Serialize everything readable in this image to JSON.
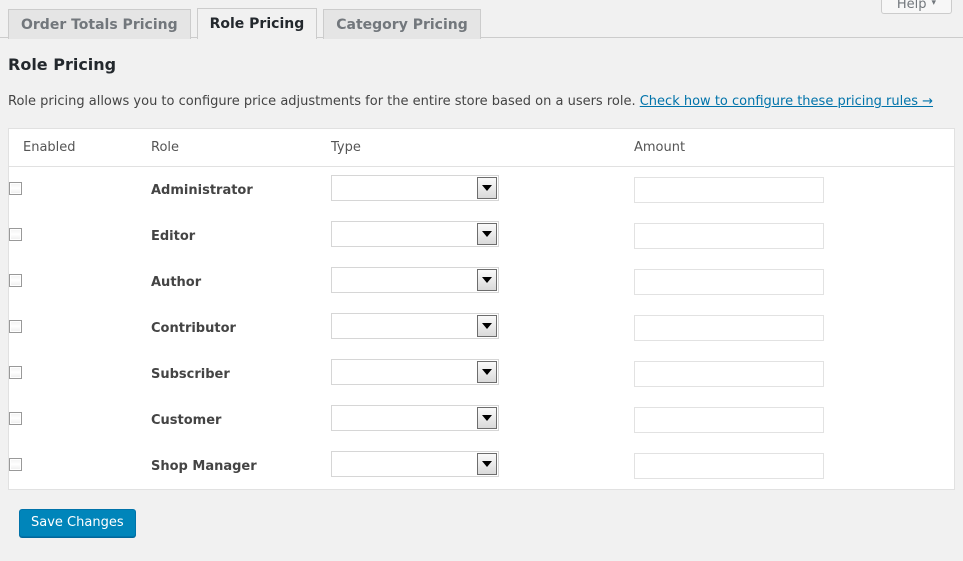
{
  "help": {
    "label": "Help",
    "caret": "▾"
  },
  "tabs": [
    {
      "label": "Order Totals Pricing",
      "active": false
    },
    {
      "label": "Role Pricing",
      "active": true
    },
    {
      "label": "Category Pricing",
      "active": false
    }
  ],
  "page": {
    "title": "Role Pricing",
    "description": "Role pricing allows you to configure price adjustments for the entire store based on a users role.",
    "link_text": "Check how to configure these pricing rules →"
  },
  "table": {
    "headers": [
      "Enabled",
      "Role",
      "Type",
      "Amount"
    ],
    "rows": [
      {
        "role": "Administrator",
        "enabled": false,
        "type": "",
        "amount": ""
      },
      {
        "role": "Editor",
        "enabled": false,
        "type": "",
        "amount": ""
      },
      {
        "role": "Author",
        "enabled": false,
        "type": "",
        "amount": ""
      },
      {
        "role": "Contributor",
        "enabled": false,
        "type": "",
        "amount": ""
      },
      {
        "role": "Subscriber",
        "enabled": false,
        "type": "",
        "amount": ""
      },
      {
        "role": "Customer",
        "enabled": false,
        "type": "",
        "amount": ""
      },
      {
        "role": "Shop Manager",
        "enabled": false,
        "type": "",
        "amount": ""
      }
    ]
  },
  "footer": {
    "save_label": "Save Changes"
  },
  "colors": {
    "accent": "#0085ba",
    "link": "#0073aa",
    "page_background": "#f1f1f1",
    "panel_background": "#ffffff",
    "tab_inactive": "#e5e5e5"
  }
}
